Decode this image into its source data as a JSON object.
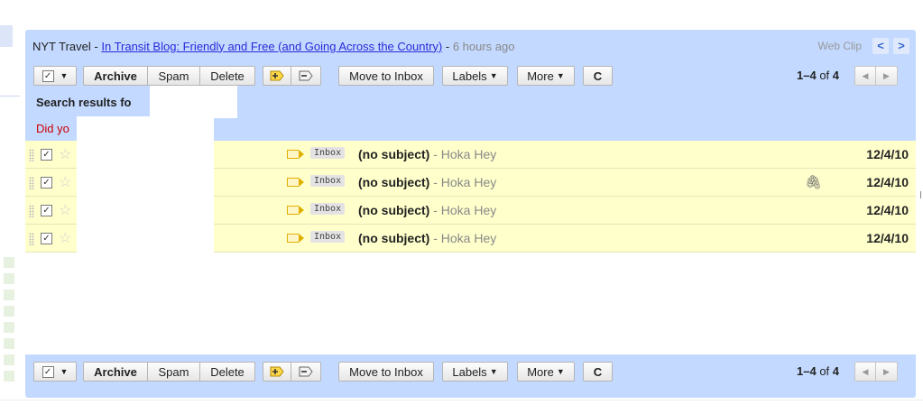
{
  "webclip": {
    "source": "NYT Travel - ",
    "link": "In Transit Blog: Friendly and Free (and Going Across the Country)",
    "sep": " - ",
    "ago": "6 hours ago",
    "label": "Web Clip",
    "prev": "<",
    "next": ">"
  },
  "toolbar": {
    "select_check": "✓",
    "select_arrow": "▼",
    "archive": "Archive",
    "spam": "Spam",
    "delete": "Delete",
    "important_icon": "label-add-icon",
    "unimportant_icon": "label-remove-icon",
    "move_to_inbox": "Move to Inbox",
    "labels": "Labels",
    "more": "More",
    "dropdown_arrow": "▼",
    "refresh": "C",
    "range": "1–4",
    "of": " of ",
    "total": "4",
    "prev_page": "◀",
    "next_page": "▶"
  },
  "search": {
    "heading": "Search results fo",
    "did_you": "Did yo"
  },
  "messages": [
    {
      "checked": "✓",
      "star": "☆",
      "label": "Inbox",
      "subject": "(no subject)",
      "snippet": " - Hoka Hey",
      "attachment": false,
      "date": "12/4/10"
    },
    {
      "checked": "✓",
      "star": "☆",
      "label": "Inbox",
      "subject": "(no subject)",
      "snippet": " - Hoka Hey",
      "attachment": true,
      "date": "12/4/10"
    },
    {
      "checked": "✓",
      "star": "☆",
      "label": "Inbox",
      "subject": "(no subject)",
      "snippet": " - Hoka Hey",
      "attachment": false,
      "date": "12/4/10"
    },
    {
      "checked": "✓",
      "star": "☆",
      "label": "Inbox",
      "subject": "(no subject)",
      "snippet": " - Hoka Hey",
      "attachment": false,
      "date": "12/4/10"
    }
  ],
  "attachment_icon": "paperclip-icon",
  "attachment_glyph": "🖇",
  "colors": {
    "panel": "#c3d9ff",
    "row_bg": "#ffffcc",
    "link": "#2a2ad8",
    "did_you": "#cc0000"
  }
}
